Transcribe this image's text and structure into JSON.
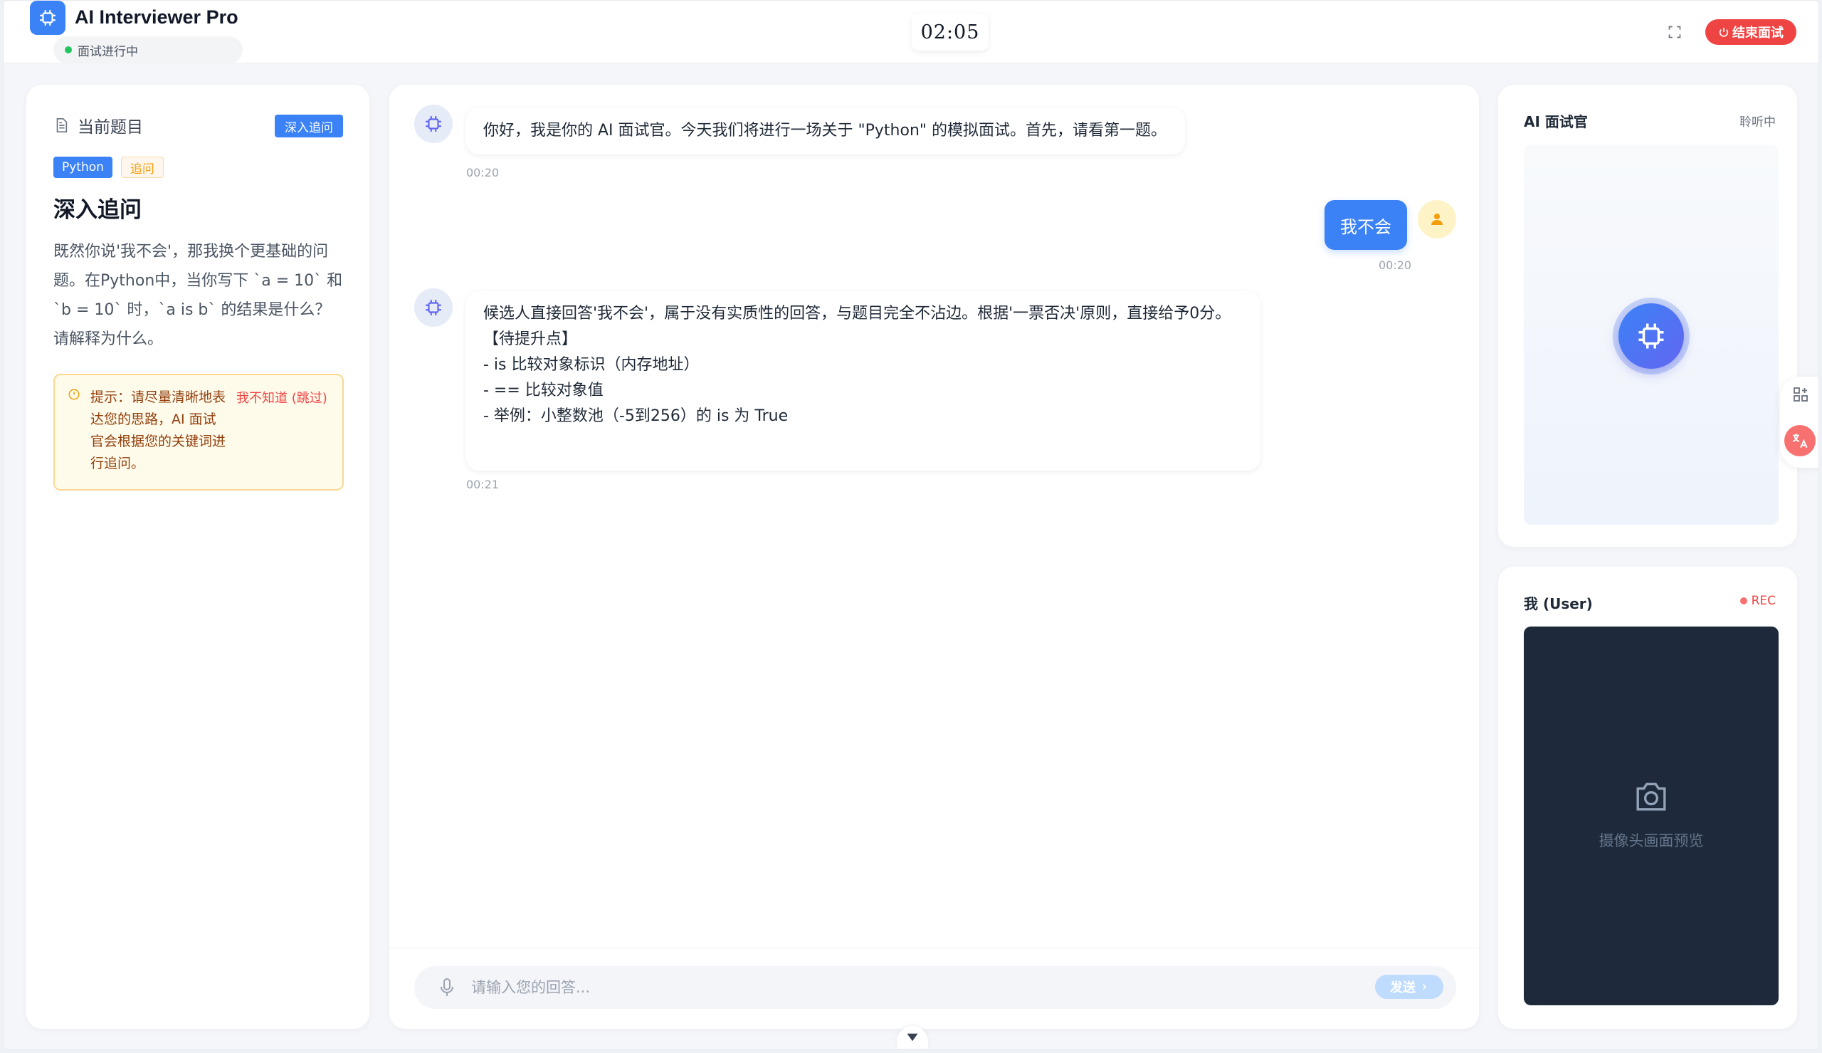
{
  "header": {
    "app_title": "AI Interviewer Pro",
    "status": "面试进行中",
    "timer": "02:05",
    "end_label": "结束面试"
  },
  "question": {
    "section_label": "当前题目",
    "badge": "深入追问",
    "tags": [
      "Python",
      "追问"
    ],
    "title": "深入追问",
    "body": "既然你说'我不会'，那我换个更基础的问题。在Python中，当你写下 `a = 10` 和 `b = 10` 时，`a is b` 的结果是什么？请解释为什么。",
    "hint": "提示：请尽量清晰地表达您的思路，AI 面试官会根据您的关键词进行追问。",
    "skip": "我不知道 (跳过)"
  },
  "chat": {
    "messages": [
      {
        "role": "ai",
        "text": "你好，我是你的 AI 面试官。今天我们将进行一场关于 \"Python\" 的模拟面试。首先，请看第一题。",
        "time": "00:20"
      },
      {
        "role": "user",
        "text": "我不会",
        "time": "00:20"
      },
      {
        "role": "ai",
        "lines": [
          "候选人直接回答'我不会'，属于没有实质性的回答，与题目完全不沾边。根据'一票否决'原则，直接给予0分。",
          "",
          "【待提升点】",
          "- is 比较对象标识（内存地址）",
          "- == 比较对象值",
          "- 举例：小整数池（-5到256）的 is 为 True"
        ],
        "time": "00:21"
      }
    ],
    "input_placeholder": "请输入您的回答...",
    "input_value": "",
    "send_label": "发送"
  },
  "ai_panel": {
    "title": "AI 面试官",
    "status": "聆听中"
  },
  "user_panel": {
    "title": "我 (User)",
    "rec_label": "REC",
    "camera_label": "摄像头画面预览"
  },
  "colors": {
    "accent": "#3b82f6",
    "danger": "#ef4444",
    "live": "#22c55e"
  }
}
